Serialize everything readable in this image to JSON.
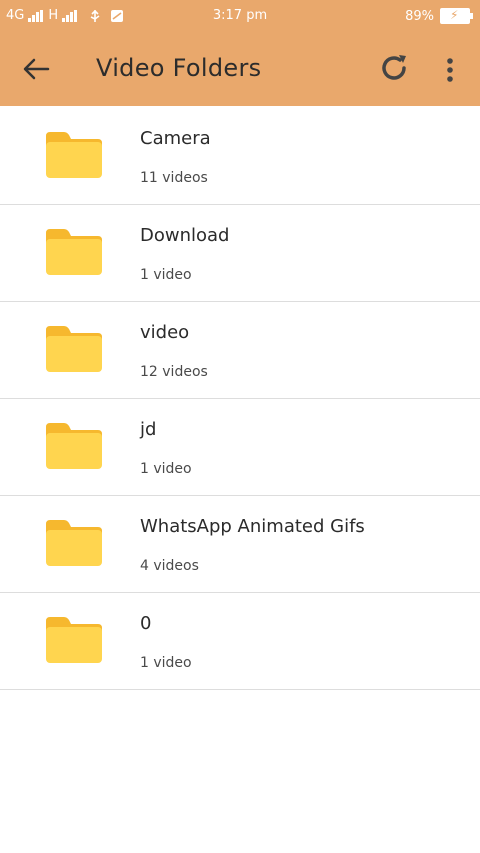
{
  "status_bar": {
    "network_4g": "4G",
    "network_h": "H",
    "time": "3:17 pm",
    "battery": "89%"
  },
  "toolbar": {
    "title": "Video Folders",
    "icons": {
      "back": "arrow-left-icon",
      "refresh": "refresh-icon",
      "more": "more-vert-icon"
    }
  },
  "folders": [
    {
      "name": "Camera",
      "count": "11 videos"
    },
    {
      "name": "Download",
      "count": "1 video"
    },
    {
      "name": "video",
      "count": "12 videos"
    },
    {
      "name": "jd",
      "count": "1 video"
    },
    {
      "name": "WhatsApp Animated Gifs",
      "count": "4 videos"
    },
    {
      "name": "0",
      "count": "1 video"
    }
  ],
  "colors": {
    "header": "#E9A86C",
    "folder": "#FFD54F",
    "folder_tab": "#F6B82E",
    "divider": "#DDDDDD"
  }
}
